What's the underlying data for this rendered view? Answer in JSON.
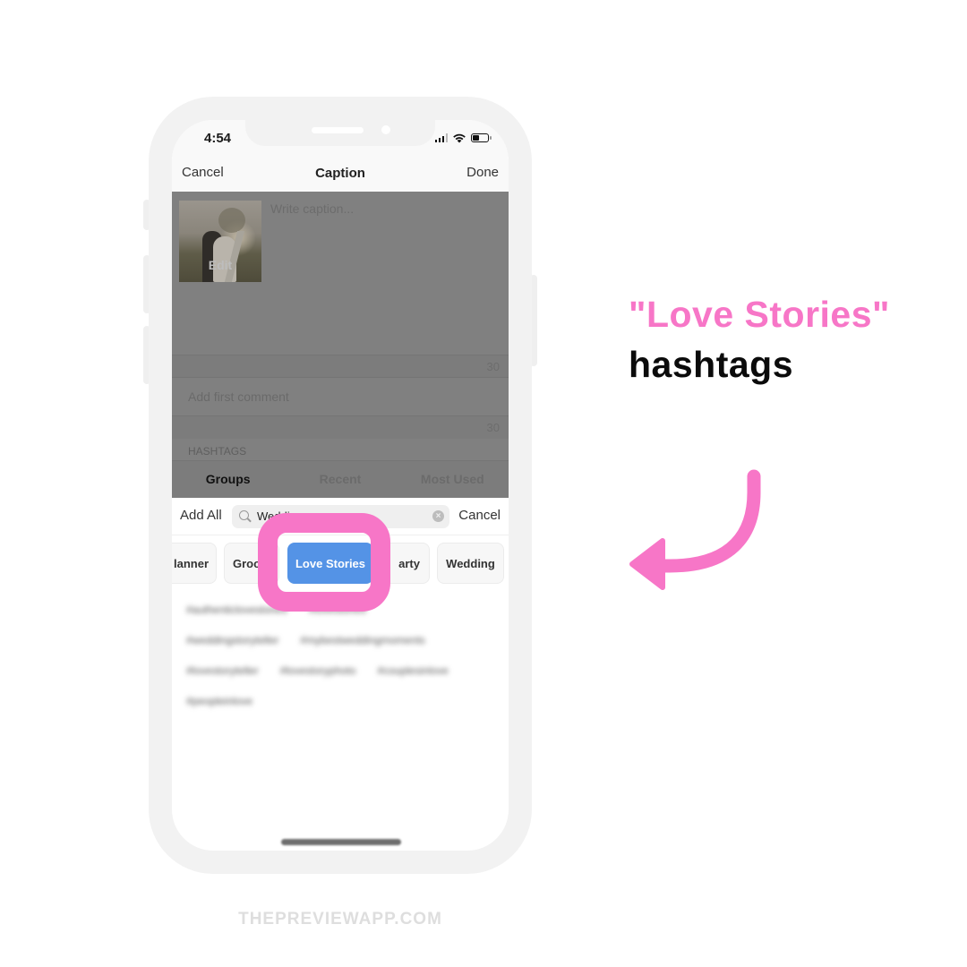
{
  "status_bar": {
    "time": "4:54",
    "battery_level": 0.45
  },
  "nav": {
    "cancel": "Cancel",
    "title": "Caption",
    "done": "Done"
  },
  "caption": {
    "thumbnail_label": "Edit",
    "placeholder": "Write caption...",
    "char_count": "30"
  },
  "comment": {
    "placeholder": "Add first comment",
    "char_count": "30"
  },
  "hashtags": {
    "section_label": "HASHTAGS",
    "tabs": [
      {
        "label": "Groups",
        "active": true
      },
      {
        "label": "Recent",
        "active": false
      },
      {
        "label": "Most Used",
        "active": false
      }
    ],
    "add_all": "Add All",
    "search_value": "Wedding",
    "search_cancel": "Cancel",
    "groups": [
      {
        "label": "Planner",
        "visible_text": "lanner"
      },
      {
        "label": "Groom",
        "visible_text": "Groo"
      },
      {
        "label": "Love Stories",
        "visible_text": "Love Stories",
        "selected": true
      },
      {
        "label": "Party",
        "visible_text": "arty"
      },
      {
        "label": "Wedding",
        "visible_text": "Wedding"
      }
    ],
    "tag_rows": [
      [
        "#authenticlovestories",
        "#lovestories"
      ],
      [
        "#weddingstoryteller",
        "#mybestweddingmoments"
      ],
      [
        "#lovestoryteller",
        "#lovestoryphoto",
        "#couplesinlove"
      ],
      [
        "#peopleinlove"
      ]
    ]
  },
  "callout": {
    "line1": "\"Love Stories\"",
    "line2": "hashtags",
    "accent_color": "#f776c7"
  },
  "footer": {
    "brand": "THEPREVIEWAPP.COM"
  }
}
